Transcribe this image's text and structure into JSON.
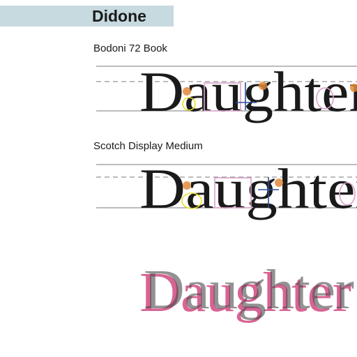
{
  "section": {
    "title": "Didone"
  },
  "specimens": [
    {
      "label": "Bodoni 72 Book",
      "word": "Daughter"
    },
    {
      "label": "Scotch Display Medium",
      "word": "Daughter"
    }
  ],
  "overlay": {
    "word": "Daughter"
  },
  "colors": {
    "header_band": "#c6dadf",
    "guide_lines": "#7a7a7a",
    "annotation_pink": "#d9a0c8",
    "annotation_yellow": "#e8e02a",
    "annotation_orange": "#e08a3a",
    "annotation_blue": "#2a4f9a",
    "overlay_pink": "#d34f86",
    "overlay_gray": "#4a4a4a"
  }
}
